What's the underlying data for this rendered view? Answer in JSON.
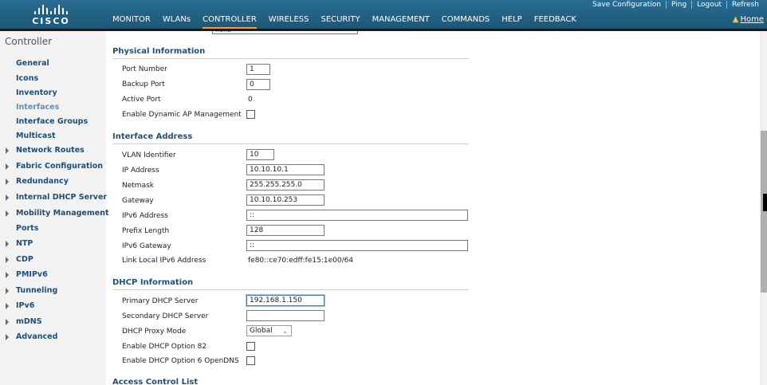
{
  "brand": {
    "name": "CISCO"
  },
  "util_links": [
    "Save Configuration",
    "Ping",
    "Logout",
    "Refresh"
  ],
  "nav": [
    "MONITOR",
    "WLANs",
    "CONTROLLER",
    "WIRELESS",
    "SECURITY",
    "MANAGEMENT",
    "COMMANDS",
    "HELP",
    "FEEDBACK"
  ],
  "nav_active": "CONTROLLER",
  "home_label": "Home",
  "sidebar": {
    "title": "Controller",
    "items": [
      {
        "label": "General",
        "expandable": false
      },
      {
        "label": "Icons",
        "expandable": false
      },
      {
        "label": "Inventory",
        "expandable": false
      },
      {
        "label": "Interfaces",
        "expandable": false,
        "current": true
      },
      {
        "label": "Interface Groups",
        "expandable": false
      },
      {
        "label": "Multicast",
        "expandable": false
      },
      {
        "label": "Network Routes",
        "expandable": true
      },
      {
        "label": "Fabric Configuration",
        "expandable": true
      },
      {
        "label": "Redundancy",
        "expandable": true
      },
      {
        "label": "Internal DHCP Server",
        "expandable": true
      },
      {
        "label": "Mobility Management",
        "expandable": true
      },
      {
        "label": "Ports",
        "expandable": false
      },
      {
        "label": "NTP",
        "expandable": true
      },
      {
        "label": "CDP",
        "expandable": true
      },
      {
        "label": "PMIPv6",
        "expandable": true
      },
      {
        "label": "Tunneling",
        "expandable": true
      },
      {
        "label": "IPv6",
        "expandable": true
      },
      {
        "label": "mDNS",
        "expandable": true
      },
      {
        "label": "Advanced",
        "expandable": true
      }
    ]
  },
  "top_cut": {
    "value": "none"
  },
  "physical": {
    "title": "Physical Information",
    "port_number_label": "Port Number",
    "port_number": "1",
    "backup_port_label": "Backup Port",
    "backup_port": "0",
    "active_port_label": "Active Port",
    "active_port": "0",
    "dynamic_ap_label": "Enable Dynamic AP Management"
  },
  "iface": {
    "title": "Interface Address",
    "vlan_label": "VLAN Identifier",
    "vlan": "10",
    "ip_label": "IP Address",
    "ip": "10.10.10.1",
    "netmask_label": "Netmask",
    "netmask": "255.255.255.0",
    "gateway_label": "Gateway",
    "gateway": "10.10.10.253",
    "ipv6_label": "IPv6 Address",
    "ipv6": "::",
    "prefix_label": "Prefix Length",
    "prefix": "128",
    "ipv6_gw_label": "IPv6 Gateway",
    "ipv6_gw": "::",
    "link_local_label": "Link Local IPv6 Address",
    "link_local": "fe80::ce70:edff:fe15:1e00/64"
  },
  "dhcp": {
    "title": "DHCP Information",
    "primary_label": "Primary DHCP Server",
    "primary": "192.168.1.150",
    "secondary_label": "Secondary DHCP Server",
    "secondary": "",
    "proxy_label": "DHCP Proxy Mode",
    "proxy": "Global",
    "opt82_label": "Enable DHCP Option 82",
    "opt6_label": "Enable DHCP Option 6 OpenDNS"
  },
  "acl": {
    "title": "Access Control List"
  }
}
